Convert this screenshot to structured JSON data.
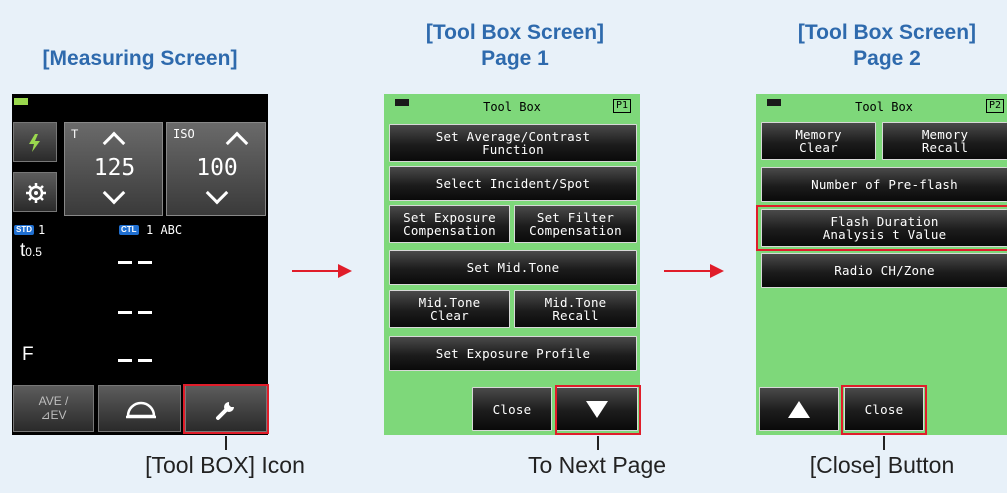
{
  "headings": {
    "measuring": "[Measuring Screen]",
    "toolbox_p1_line1": "[Tool Box Screen]",
    "toolbox_p1_line2": "Page 1",
    "toolbox_p2_line1": "[Tool Box Screen]",
    "toolbox_p2_line2": "Page 2"
  },
  "captions": {
    "toolbox_icon": "[Tool BOX] Icon",
    "next_page": "To Next Page",
    "close_button": "[Close] Button"
  },
  "measuring": {
    "shutter_label": "T",
    "shutter_value": "125",
    "iso_label": "ISO",
    "iso_value": "100",
    "std_tag": "STD",
    "std_value": "1",
    "ctl_tag": "CTL",
    "ctl_value": "1 ABC",
    "t_label": "t",
    "t_sub": "0.5",
    "f_label": "F",
    "ave_label_line1": "AVE /",
    "ave_label_line2": "⊿EV"
  },
  "toolbox_p1": {
    "title": "Tool Box",
    "page_badge": "P1",
    "buttons": {
      "avg_contrast": "Set Average/Contrast\nFunction",
      "incident_spot": "Select Incident/Spot",
      "exposure_comp": "Set Exposure\nCompensation",
      "filter_comp": "Set Filter\nCompensation",
      "mid_tone": "Set Mid.Tone",
      "mid_tone_clear": "Mid.Tone\nClear",
      "mid_tone_recall": "Mid.Tone\nRecall",
      "exposure_profile": "Set Exposure Profile",
      "close": "Close"
    }
  },
  "toolbox_p2": {
    "title": "Tool Box",
    "page_badge": "P2",
    "buttons": {
      "memory_clear": "Memory\nClear",
      "memory_recall": "Memory\nRecall",
      "pre_flash": "Number of Pre-flash",
      "flash_duration": "Flash Duration\nAnalysis t Value",
      "radio": "Radio CH/Zone",
      "close": "Close"
    }
  },
  "colors": {
    "heading": "#2e6aad",
    "highlight": "#e01d2a",
    "screen_green": "#7ed87a",
    "background": "#e8f1f9"
  }
}
